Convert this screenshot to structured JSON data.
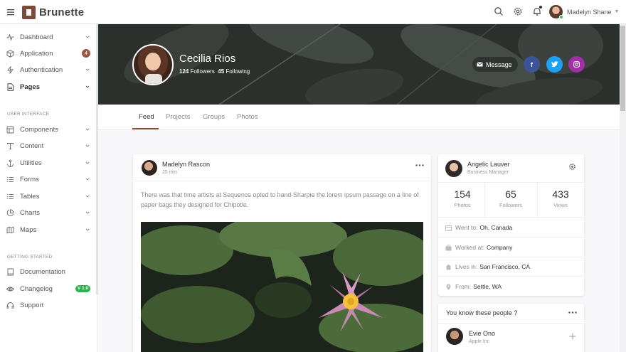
{
  "brand": {
    "name": "Brunette",
    "color": "#7a4a3a"
  },
  "topbar": {
    "user_name": "Madelyn Shane"
  },
  "sidebar": {
    "items": [
      {
        "label": "Dashboard"
      },
      {
        "label": "Application",
        "badge": "4"
      },
      {
        "label": "Authentication"
      },
      {
        "label": "Pages"
      }
    ],
    "section_ui": "USER INTERFACE",
    "ui_items": [
      {
        "label": "Components"
      },
      {
        "label": "Content"
      },
      {
        "label": "Utilities"
      },
      {
        "label": "Forms"
      },
      {
        "label": "Tables"
      },
      {
        "label": "Charts"
      },
      {
        "label": "Maps"
      }
    ],
    "section_start": "GETTING STARTED",
    "start_items": [
      {
        "label": "Documentation"
      },
      {
        "label": "Changelog",
        "badge": "V 1.0"
      },
      {
        "label": "Support"
      }
    ]
  },
  "profile": {
    "name": "Cecilia Rios",
    "followers_count": "124",
    "followers_label": "Followers",
    "following_count": "45",
    "following_label": "Following",
    "message_label": "Message",
    "social": {
      "facebook": "f",
      "twitter": "twitter-icon",
      "instagram": "instagram-icon"
    }
  },
  "tabs": [
    {
      "label": "Feed",
      "active": true
    },
    {
      "label": "Projects"
    },
    {
      "label": "Groups"
    },
    {
      "label": "Photos"
    }
  ],
  "post": {
    "author": "Madelyn Rascon",
    "time": "25 min",
    "text": "There was that time artists at Sequence opted to hand-Sharpie the lorem ipsum passage on a line of paper bags they designed for Chipotle."
  },
  "side_profile": {
    "name": "Angelic Lauver",
    "role": "Business Manager",
    "stats": [
      {
        "value": "154",
        "label": "Photos"
      },
      {
        "value": "65",
        "label": "Followers"
      },
      {
        "value": "433",
        "label": "Views"
      }
    ],
    "info": [
      {
        "label": "Went to:",
        "value": "Oh, Canada"
      },
      {
        "label": "Worked at:",
        "value": "Company"
      },
      {
        "label": "Lives in:",
        "value": "San Francisco, CA"
      },
      {
        "label": "From:",
        "value": "Settle, WA"
      }
    ]
  },
  "people": {
    "title": "You know these people ?",
    "items": [
      {
        "name": "Evie Ono",
        "company": "Apple Inc"
      }
    ]
  },
  "colors": {
    "accent": "#8b4a32",
    "success": "#2db34a",
    "badge": "#9a5a42"
  }
}
